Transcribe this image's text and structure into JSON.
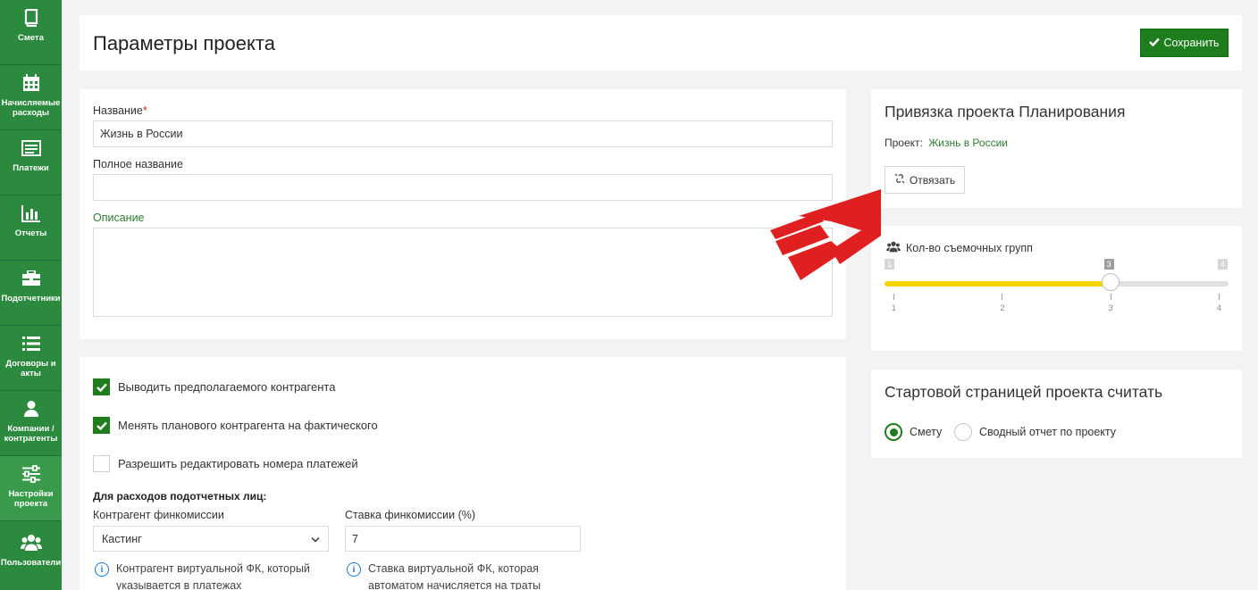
{
  "sidebar": {
    "items": [
      {
        "label": "Смета",
        "icon": "book-icon"
      },
      {
        "label": "Начисляемые расходы",
        "icon": "calendar-icon"
      },
      {
        "label": "Платежи",
        "icon": "list-card-icon"
      },
      {
        "label": "Отчеты",
        "icon": "bar-chart-icon"
      },
      {
        "label": "Подотчетники",
        "icon": "briefcase-icon"
      },
      {
        "label": "Договоры и акты",
        "icon": "list-icon"
      },
      {
        "label": "Компании / контрагенты",
        "icon": "user-icon"
      },
      {
        "label": "Настройки проекта",
        "icon": "sliders-icon"
      },
      {
        "label": "Пользователи",
        "icon": "users-icon"
      }
    ]
  },
  "header": {
    "title": "Параметры проекта",
    "save_label": "Сохранить"
  },
  "form": {
    "name_label": "Название",
    "name_required": "*",
    "name_value": "Жизнь в России",
    "fullname_label": "Полное название",
    "fullname_value": "",
    "description_label": "Описание",
    "description_value": ""
  },
  "options": {
    "checkboxes": [
      {
        "label": "Выводить предполагаемого контрагента",
        "checked": true
      },
      {
        "label": "Менять планового контрагента на фактического",
        "checked": true
      },
      {
        "label": "Разрешить редактировать номера платежей",
        "checked": false
      }
    ],
    "accountable_heading": "Для расходов подотчетных лиц:",
    "counterparty_label": "Контрагент финкомиссии",
    "counterparty_value": "Кастинг",
    "rate_label": "Ставка финкомиссии (%)",
    "rate_value": "7",
    "counterparty_info": "Контрагент виртуальной ФК, который указывается в платежах",
    "rate_info": "Ставка виртуальной ФК, которая автоматом начисляется на траты"
  },
  "planning": {
    "title": "Привязка проекта Планирования",
    "project_label": "Проект:",
    "project_link": "Жизнь в России",
    "unlink_label": "Отвязать"
  },
  "crews": {
    "label": "Кол-во съемочных групп",
    "min": 1,
    "max": 4,
    "value": 3,
    "min_label": "1",
    "max_label": "4",
    "value_label": "3",
    "ticks": [
      "1",
      "2",
      "3",
      "4"
    ],
    "fill_color": "#f5d400"
  },
  "startpage": {
    "title": "Стартовой страницей проекта считать",
    "options": [
      {
        "label": "Смету",
        "selected": true
      },
      {
        "label": "Сводный отчет по проекту",
        "selected": false
      }
    ]
  },
  "colors": {
    "accent": "#1e7e1e",
    "sidebar": "#2b8a3e",
    "link": "#2e7d32",
    "arrow": "#e02020"
  }
}
